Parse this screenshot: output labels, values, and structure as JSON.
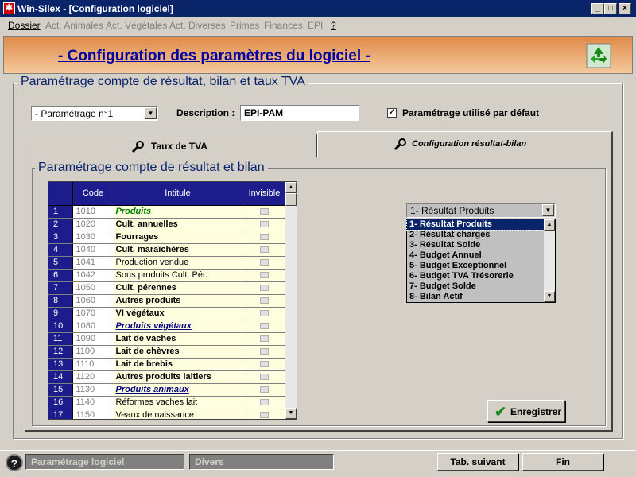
{
  "window": {
    "title": "Win-Silex - [Configuration logiciel]"
  },
  "menu": [
    "Dossier",
    "Act. Animales",
    "Act. Végétales",
    "Act. Diverses",
    "Primes",
    "Finances",
    "EPI",
    "?"
  ],
  "header": {
    "title": "- Configuration des paramètres du logiciel -"
  },
  "main_group": {
    "label": "Paramétrage compte de résultat, bilan et taux TVA"
  },
  "param_select": {
    "value": "- Paramétrage n°1"
  },
  "description": {
    "label": "Description :",
    "value": "EPI-PAM"
  },
  "default_checkbox": {
    "label": "Paramétrage utilisé par défaut",
    "checked": true
  },
  "tabs": [
    {
      "label": "Taux de TVA"
    },
    {
      "label": "Configuration résultat-bilan"
    }
  ],
  "sub_group": {
    "label": "Paramétrage compte de résultat et bilan"
  },
  "grid": {
    "headers": {
      "code": "Code",
      "intitule": "Intitule",
      "invisible": "Invisible"
    },
    "rows": [
      {
        "n": "1",
        "code": "1010",
        "label": "Produits",
        "style": "gi"
      },
      {
        "n": "2",
        "code": "1020",
        "label": "Cult. annuelles",
        "style": "b"
      },
      {
        "n": "3",
        "code": "1030",
        "label": "Fourrages",
        "style": "b"
      },
      {
        "n": "4",
        "code": "1040",
        "label": "Cult. maraîchères",
        "style": "b"
      },
      {
        "n": "5",
        "code": "1041",
        "label": "Production vendue",
        "style": ""
      },
      {
        "n": "6",
        "code": "1042",
        "label": "Sous produits Cult. Pér.",
        "style": ""
      },
      {
        "n": "7",
        "code": "1050",
        "label": "Cult. pérennes",
        "style": "b"
      },
      {
        "n": "8",
        "code": "1060",
        "label": "Autres produits",
        "style": "b"
      },
      {
        "n": "9",
        "code": "1070",
        "label": "VI végétaux",
        "style": "b"
      },
      {
        "n": "10",
        "code": "1080",
        "label": "Produits végétaux",
        "style": "bi"
      },
      {
        "n": "11",
        "code": "1090",
        "label": "Lait de vaches",
        "style": "b"
      },
      {
        "n": "12",
        "code": "1100",
        "label": "Lait de chèvres",
        "style": "b"
      },
      {
        "n": "13",
        "code": "1110",
        "label": "Lait de brebis",
        "style": "b"
      },
      {
        "n": "14",
        "code": "1120",
        "label": "Autres produits laitiers",
        "style": "b"
      },
      {
        "n": "15",
        "code": "1130",
        "label": "Produits animaux",
        "style": "bi"
      },
      {
        "n": "16",
        "code": "1140",
        "label": "Réformes vaches lait",
        "style": ""
      },
      {
        "n": "17",
        "code": "1150",
        "label": "Veaux de naissance",
        "style": ""
      }
    ]
  },
  "type_select": {
    "value": "1- Résultat Produits"
  },
  "type_list": [
    "1- Résultat Produits",
    "2- Résultat charges",
    "3- Résultat Solde",
    "4- Budget Annuel",
    "5- Budget Exceptionnel",
    "6- Budget TVA Trésorerie",
    "7- Budget Solde",
    "8- Bilan Actif"
  ],
  "save_button": {
    "label": "Enregistrer"
  },
  "statusbar": {
    "help": "?",
    "field1": "Paramétrage logiciel",
    "field2": "Divers",
    "next_tab": "Tab. suivant",
    "end": "Fin"
  },
  "colors": {
    "title_bar": "#0a246a",
    "header_gradient_top": "#e08a48",
    "grid_header": "#1c1c8c",
    "accent_title": "#0000a0"
  }
}
